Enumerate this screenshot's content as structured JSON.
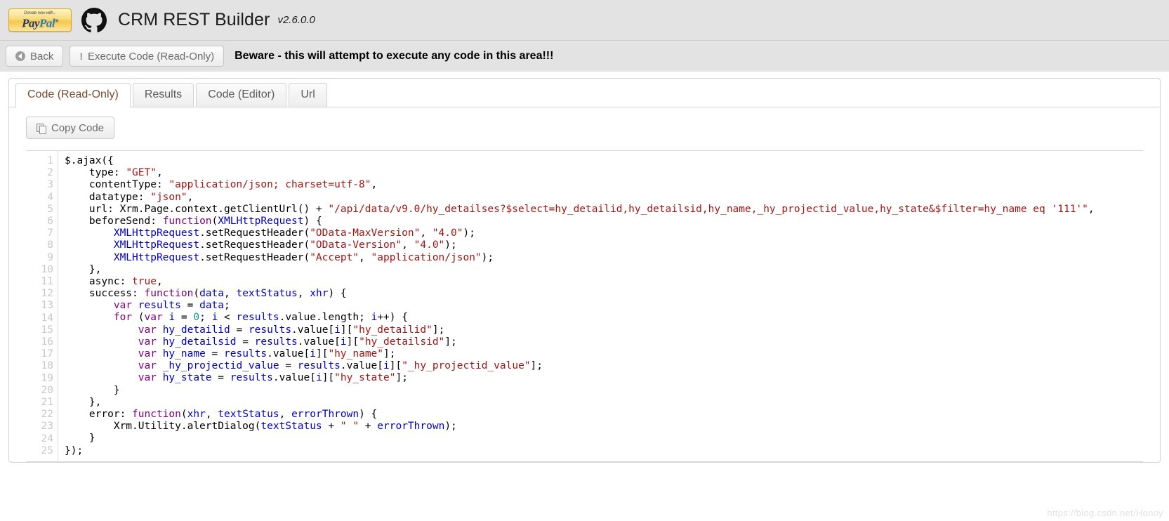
{
  "header": {
    "paypal": {
      "top_text": "Donate now with...",
      "brand_pay": "Pay",
      "brand_pal": "Pal",
      "reg": "®"
    },
    "github_icon": "github-octocat-icon",
    "title": "CRM REST Builder",
    "version": "v2.6.0.0"
  },
  "toolbar": {
    "back_label": "Back",
    "execute_label": "Execute Code (Read-Only)",
    "warning": "Beware - this will attempt to execute any code in this area!!!"
  },
  "tabs": [
    {
      "label": "Code (Read-Only)",
      "active": true
    },
    {
      "label": "Results",
      "active": false
    },
    {
      "label": "Code (Editor)",
      "active": false
    },
    {
      "label": "Url",
      "active": false
    }
  ],
  "content": {
    "copy_button_label": "Copy Code",
    "copy_icon": "copy-icon"
  },
  "code": {
    "line_numbers": [
      "1",
      "2",
      "3",
      "4",
      "5",
      "6",
      "7",
      "8",
      "9",
      "10",
      "11",
      "12",
      "13",
      "14",
      "15",
      "16",
      "17",
      "18",
      "19",
      "20",
      "21",
      "22",
      "23",
      "24",
      "25"
    ],
    "lines": [
      "$.ajax({",
      "    type: \"GET\",",
      "    contentType: \"application/json; charset=utf-8\",",
      "    datatype: \"json\",",
      "    url: Xrm.Page.context.getClientUrl() + \"/api/data/v9.0/hy_detailses?$select=hy_detailid,hy_detailsid,hy_name,_hy_projectid_value,hy_state&$filter=hy_name eq '111'\",",
      "    beforeSend: function(XMLHttpRequest) {",
      "        XMLHttpRequest.setRequestHeader(\"OData-MaxVersion\", \"4.0\");",
      "        XMLHttpRequest.setRequestHeader(\"OData-Version\", \"4.0\");",
      "        XMLHttpRequest.setRequestHeader(\"Accept\", \"application/json\");",
      "    },",
      "    async: true,",
      "    success: function(data, textStatus, xhr) {",
      "        var results = data;",
      "        for (var i = 0; i < results.value.length; i++) {",
      "            var hy_detailid = results.value[i][\"hy_detailid\"];",
      "            var hy_detailsid = results.value[i][\"hy_detailsid\"];",
      "            var hy_name = results.value[i][\"hy_name\"];",
      "            var _hy_projectid_value = results.value[i][\"_hy_projectid_value\"];",
      "            var hy_state = results.value[i][\"hy_state\"];",
      "        }",
      "    },",
      "    error: function(xhr, textStatus, errorThrown) {",
      "        Xrm.Utility.alertDialog(textStatus + \" \" + errorThrown);",
      "    }",
      "});"
    ]
  },
  "watermark": "https://blog.csdn.net/Honoy",
  "colors": {
    "header_bg": "#e3e3e3",
    "active_tab_text": "#7a4b2e",
    "string": "#a31515",
    "keyword": "#7f0055",
    "identifier": "#0000cc"
  }
}
